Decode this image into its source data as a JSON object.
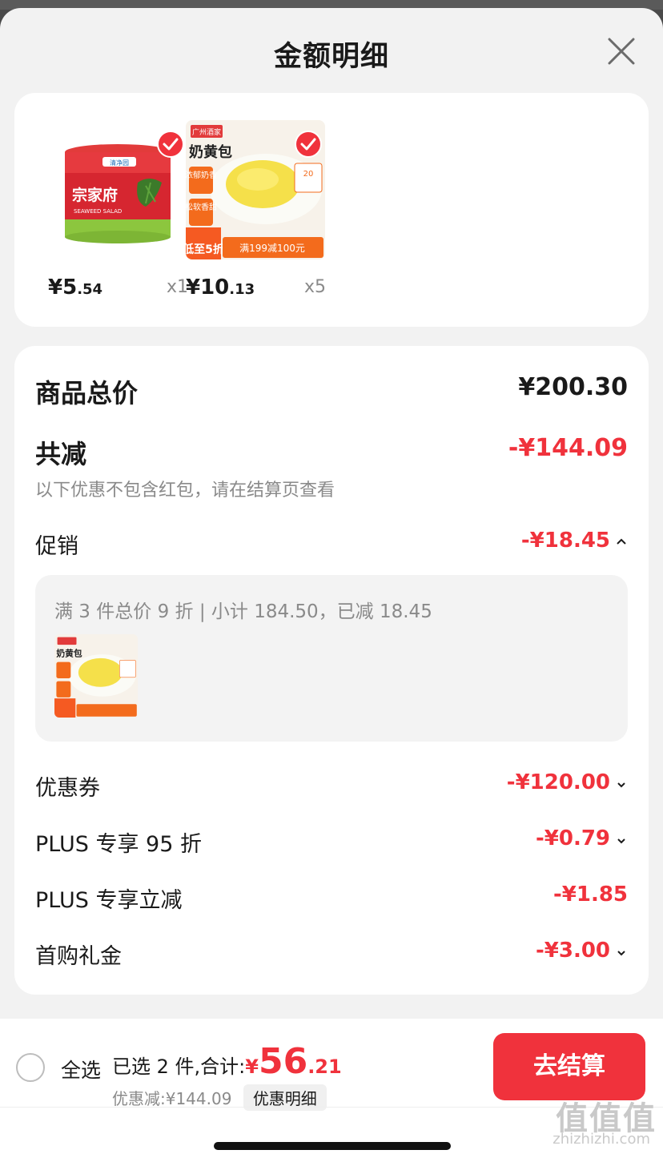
{
  "header": {
    "title": "金额明细"
  },
  "products": [
    {
      "name": "宗家府海藻色拉",
      "brand": "清净园",
      "subtitle": "SEAWEED SALAD",
      "price_int": "¥5",
      "price_dec": ".54",
      "qty": "x1",
      "thumb_bg": "#e8f3d5",
      "accent": "#d6202c"
    },
    {
      "name": "奶黄包",
      "brand": "广州酒家",
      "tags": [
        "浓郁奶香",
        "松软香甜"
      ],
      "promo_badge": "低至5折",
      "promo_line": "满199减100元",
      "price_int": "¥10",
      "price_dec": ".13",
      "qty": "x5",
      "thumb_bg": "#f7f2ea",
      "accent": "#f55a22"
    }
  ],
  "summary": {
    "total_label": "商品总价",
    "total_value": "¥200.30",
    "reduce_label": "共减",
    "reduce_value": "-¥144.09",
    "reduce_note": "以下优惠不包含红包，请在结算页查看",
    "promo_label": "促销",
    "promo_value": "-¥18.45",
    "promo_detail": "满 3 件总价 9 折 | 小计 184.50，已减 18.45",
    "coupon_label": "优惠券",
    "coupon_value": "-¥120.00",
    "plus95_label": "PLUS 专享 95 折",
    "plus95_value": "-¥0.79",
    "plus_cut_label": "PLUS 专享立减",
    "plus_cut_value": "-¥1.85",
    "first_buy_label": "首购礼金",
    "first_buy_value": "-¥3.00"
  },
  "bottom": {
    "select_all": "全选",
    "selected_prefix": "已选 2 件,合计:",
    "total_sym": "¥",
    "total_int": "56",
    "total_dec": ".21",
    "discount": "优惠减:¥144.09",
    "detail_link": "优惠明细",
    "checkout": "去结算"
  },
  "watermark": {
    "logo": "值值值",
    "site": "zhizhizhi.com"
  },
  "colors": {
    "accent_red": "#f0323c",
    "muted": "#8a8a8a"
  }
}
